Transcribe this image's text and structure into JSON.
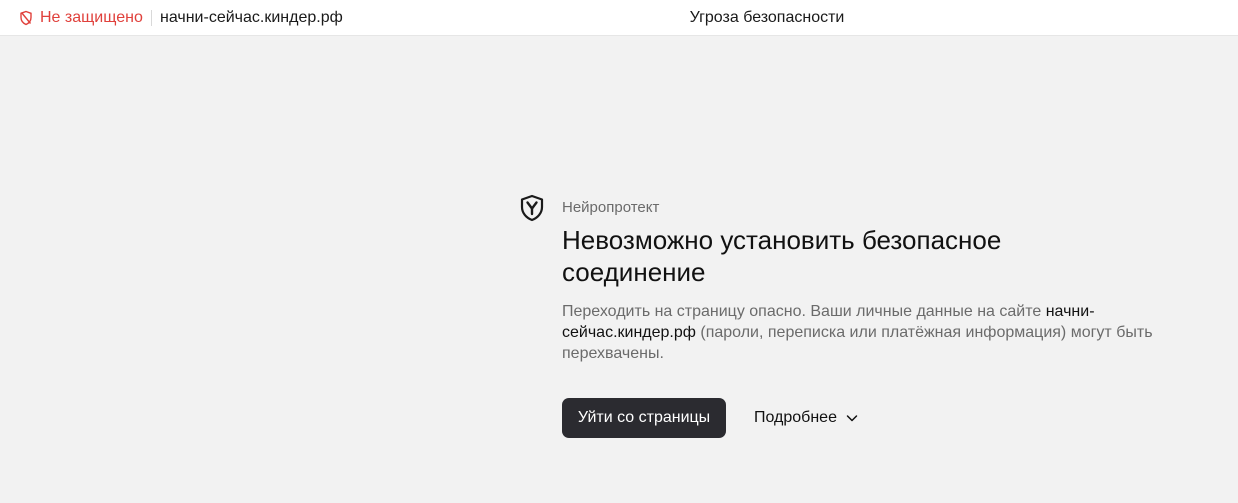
{
  "topbar": {
    "security_label": "Не защищено",
    "security_icon": "shield-slash-icon",
    "security_color": "#e0413c",
    "url": "начни-сейчас.киндер.рф",
    "page_title": "Угроза безопасности"
  },
  "warning": {
    "product_icon": "yandex-shield-icon",
    "product_name": "Нейропротект",
    "headline": "Невозможно установить безопасное соединение",
    "description_before": "Переходить на страницу опасно. Ваши личные данные на сайте ",
    "description_domain": "начни-сейчас.киндер.рф",
    "description_after": " (пароли, переписка или платёжная информация) могут быть перехвачены.",
    "leave_button": "Уйти со страницы",
    "more_button": "Подробнее",
    "more_icon": "chevron-down-icon"
  }
}
